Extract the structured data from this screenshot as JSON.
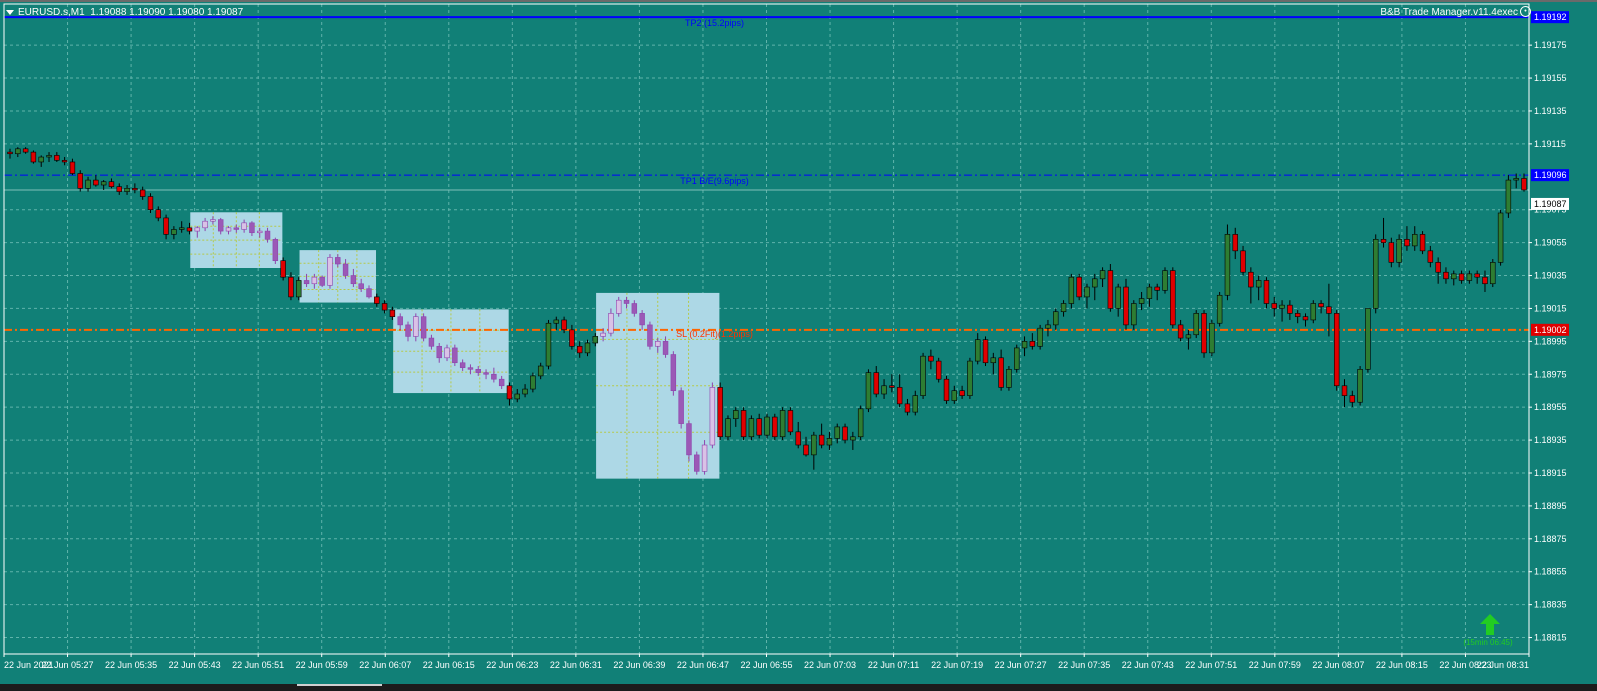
{
  "header": {
    "symbol": "EURUSD.s,M1",
    "ohlc": "1.19088 1.19090 1.19080 1.19087",
    "ea_name": "B&B Trade Manager.v11.4exec"
  },
  "colors": {
    "background": "#118077",
    "bull": "#2e7d32",
    "bear": "#e00000",
    "highlight_candle": "#9b59b6",
    "zone": "#add8e6",
    "tp_line": "#0000ff",
    "sl_line": "#ff6600",
    "bid_label": "#ffffff",
    "signal_arrow": "#22cc22"
  },
  "price_axis": {
    "labels": [
      "1.19192",
      "1.19175",
      "1.19155",
      "1.19135",
      "1.19115",
      "1.19096",
      "1.19087",
      "1.19075",
      "1.19055",
      "1.19035",
      "1.19015",
      "1.19002",
      "1.18995",
      "1.18975",
      "1.18955",
      "1.18935",
      "1.18915",
      "1.18895",
      "1.18875",
      "1.18855",
      "1.18835",
      "1.18815"
    ],
    "ticks": [
      "1.19175",
      "1.19155",
      "1.19135",
      "1.19115",
      "1.19075",
      "1.19055",
      "1.19035",
      "1.19015",
      "1.18995",
      "1.18975",
      "1.18955",
      "1.18935",
      "1.18915",
      "1.18895",
      "1.18875",
      "1.18855",
      "1.18835",
      "1.18815"
    ],
    "tp2_price": "1.19192",
    "tp1_price": "1.19096",
    "current_price": "1.19087",
    "sl_price": "1.19002"
  },
  "time_axis": {
    "labels": [
      "22 Jun 2021",
      "22 Jun 05:27",
      "22 Jun 05:35",
      "22 Jun 05:43",
      "22 Jun 05:51",
      "22 Jun 05:59",
      "22 Jun 06:07",
      "22 Jun 06:15",
      "22 Jun 06:23",
      "22 Jun 06:31",
      "22 Jun 06:39",
      "22 Jun 06:47",
      "22 Jun 06:55",
      "22 Jun 07:03",
      "22 Jun 07:11",
      "22 Jun 07:19",
      "22 Jun 07:27",
      "22 Jun 07:35",
      "22 Jun 07:43",
      "22 Jun 07:51",
      "22 Jun 07:59",
      "22 Jun 08:07",
      "22 Jun 08:15",
      "22 Jun 08:23",
      "22 Jun 08:31"
    ]
  },
  "lines": {
    "tp2_label": "TP2 (15.2pips)",
    "tp1_label": "TP1 B/E(9.6pips)",
    "sl_label": "SL (0.2Fit)(1.2pips)"
  },
  "signal": {
    "icon": "up-arrow-icon",
    "label": "(15min 06:45)"
  },
  "chart_data": {
    "type": "candlestick",
    "symbol": "EURUSD.s",
    "timeframe": "M1",
    "ylim": [
      1.18805,
      1.192
    ],
    "grid": true,
    "candles": [
      [
        1.1911,
        1.19112,
        1.19106,
        1.19109
      ],
      [
        1.19109,
        1.19113,
        1.19107,
        1.19112
      ],
      [
        1.19112,
        1.19113,
        1.19109,
        1.1911
      ],
      [
        1.1911,
        1.19111,
        1.19103,
        1.19104
      ],
      [
        1.19104,
        1.19108,
        1.19101,
        1.19107
      ],
      [
        1.19107,
        1.1911,
        1.19104,
        1.19108
      ],
      [
        1.19108,
        1.1911,
        1.19104,
        1.19105
      ],
      [
        1.19105,
        1.19107,
        1.19102,
        1.19104
      ],
      [
        1.19104,
        1.19106,
        1.19096,
        1.19097
      ],
      [
        1.19097,
        1.19099,
        1.19086,
        1.19088
      ],
      [
        1.19088,
        1.19095,
        1.19086,
        1.19093
      ],
      [
        1.19093,
        1.19096,
        1.19089,
        1.1909
      ],
      [
        1.1909,
        1.19093,
        1.19087,
        1.19092
      ],
      [
        1.19092,
        1.19094,
        1.19088,
        1.19089
      ],
      [
        1.19089,
        1.19091,
        1.19084,
        1.19086
      ],
      [
        1.19086,
        1.1909,
        1.19084,
        1.19088
      ],
      [
        1.19088,
        1.19091,
        1.19085,
        1.19087
      ],
      [
        1.19087,
        1.19089,
        1.19081,
        1.19083
      ],
      [
        1.19083,
        1.19085,
        1.19073,
        1.19075
      ],
      [
        1.19075,
        1.19077,
        1.19068,
        1.1907
      ],
      [
        1.1907,
        1.19072,
        1.19057,
        1.1906
      ],
      [
        1.1906,
        1.19065,
        1.19057,
        1.19063
      ],
      [
        1.19063,
        1.19068,
        1.19061,
        1.19064
      ],
      [
        1.19064,
        1.19067,
        1.1906,
        1.19062
      ],
      [
        1.19062,
        1.19065,
        1.19058,
        1.19064
      ],
      [
        1.19064,
        1.1907,
        1.19062,
        1.19068
      ],
      [
        1.19068,
        1.19071,
        1.19066,
        1.19069
      ],
      [
        1.19069,
        1.1907,
        1.1906,
        1.19062
      ],
      [
        1.19062,
        1.19065,
        1.1906,
        1.19064
      ],
      [
        1.19064,
        1.19066,
        1.19061,
        1.19063
      ],
      [
        1.19063,
        1.19069,
        1.19061,
        1.19067
      ],
      [
        1.19067,
        1.19068,
        1.19059,
        1.19061
      ],
      [
        1.19061,
        1.19064,
        1.19058,
        1.19062
      ],
      [
        1.19062,
        1.19064,
        1.19055,
        1.19057
      ],
      [
        1.19057,
        1.19058,
        1.19042,
        1.19044
      ],
      [
        1.19044,
        1.19046,
        1.19032,
        1.19034
      ],
      [
        1.19034,
        1.19037,
        1.1902,
        1.19022
      ],
      [
        1.19022,
        1.19034,
        1.1902,
        1.19032
      ],
      [
        1.19032,
        1.19036,
        1.19028,
        1.1903
      ],
      [
        1.1903,
        1.19036,
        1.19027,
        1.19034
      ],
      [
        1.19034,
        1.19035,
        1.19028,
        1.19029
      ],
      [
        1.19029,
        1.19048,
        1.19027,
        1.19046
      ],
      [
        1.19046,
        1.19048,
        1.1904,
        1.19042
      ],
      [
        1.19042,
        1.19045,
        1.19033,
        1.19035
      ],
      [
        1.19035,
        1.19039,
        1.19028,
        1.1903
      ],
      [
        1.1903,
        1.19033,
        1.19025,
        1.19027
      ],
      [
        1.19027,
        1.19029,
        1.19021,
        1.19022
      ],
      [
        1.19022,
        1.19024,
        1.19016,
        1.19018
      ],
      [
        1.19018,
        1.1902,
        1.19012,
        1.19014
      ],
      [
        1.19014,
        1.19016,
        1.19008,
        1.1901
      ],
      [
        1.1901,
        1.19012,
        1.19002,
        1.19005
      ],
      [
        1.19005,
        1.19007,
        1.18995,
        1.18998
      ],
      [
        1.18998,
        1.19012,
        1.18995,
        1.1901
      ],
      [
        1.1901,
        1.19012,
        1.18995,
        1.18997
      ],
      [
        1.18997,
        1.18999,
        1.1899,
        1.18992
      ],
      [
        1.18992,
        1.18994,
        1.18982,
        1.18985
      ],
      [
        1.18985,
        1.18993,
        1.18983,
        1.18991
      ],
      [
        1.18991,
        1.18993,
        1.1898,
        1.18982
      ],
      [
        1.18982,
        1.18984,
        1.18977,
        1.18979
      ],
      [
        1.18979,
        1.18981,
        1.18975,
        1.18978
      ],
      [
        1.18978,
        1.1898,
        1.18974,
        1.18976
      ],
      [
        1.18976,
        1.18978,
        1.18972,
        1.18975
      ],
      [
        1.18975,
        1.18979,
        1.1897,
        1.18972
      ],
      [
        1.18972,
        1.18974,
        1.18966,
        1.18968
      ],
      [
        1.18968,
        1.1897,
        1.18956,
        1.1896
      ],
      [
        1.1896,
        1.18966,
        1.18958,
        1.18963
      ],
      [
        1.18963,
        1.18969,
        1.18961,
        1.18966
      ],
      [
        1.18966,
        1.18976,
        1.18964,
        1.18974
      ],
      [
        1.18974,
        1.18982,
        1.18972,
        1.1898
      ],
      [
        1.1898,
        1.19008,
        1.18978,
        1.19006
      ],
      [
        1.19006,
        1.1901,
        1.19002,
        1.19008
      ],
      [
        1.19008,
        1.1901,
        1.19,
        1.19002
      ],
      [
        1.19002,
        1.19005,
        1.1899,
        1.18992
      ],
      [
        1.18992,
        1.18995,
        1.18985,
        1.18988
      ],
      [
        1.18988,
        1.18996,
        1.18986,
        1.18994
      ],
      [
        1.18994,
        1.19,
        1.18992,
        1.18998
      ],
      [
        1.18998,
        1.19003,
        1.18995,
        1.19
      ],
      [
        1.19,
        1.19015,
        1.18998,
        1.19012
      ],
      [
        1.19012,
        1.19022,
        1.1901,
        1.1902
      ],
      [
        1.1902,
        1.19022,
        1.19015,
        1.19018
      ],
      [
        1.19018,
        1.1902,
        1.1901,
        1.19012
      ],
      [
        1.19012,
        1.19014,
        1.19002,
        1.19005
      ],
      [
        1.19005,
        1.19007,
        1.1899,
        1.18992
      ],
      [
        1.18992,
        1.18997,
        1.18988,
        1.18995
      ],
      [
        1.18995,
        1.18998,
        1.18985,
        1.18987
      ],
      [
        1.18987,
        1.18989,
        1.18962,
        1.18965
      ],
      [
        1.18965,
        1.18967,
        1.18942,
        1.18945
      ],
      [
        1.18945,
        1.18947,
        1.18922,
        1.18926
      ],
      [
        1.18926,
        1.18928,
        1.18914,
        1.18916
      ],
      [
        1.18916,
        1.18935,
        1.18914,
        1.18932
      ],
      [
        1.18932,
        1.1897,
        1.1893,
        1.18967
      ],
      [
        1.18967,
        1.1897,
        1.18935,
        1.18937
      ],
      [
        1.18937,
        1.1895,
        1.18935,
        1.18948
      ],
      [
        1.18948,
        1.18955,
        1.18943,
        1.18953
      ],
      [
        1.18953,
        1.18955,
        1.18935,
        1.18937
      ],
      [
        1.18937,
        1.1895,
        1.18935,
        1.18948
      ],
      [
        1.18948,
        1.18951,
        1.18936,
        1.18938
      ],
      [
        1.18938,
        1.18951,
        1.18936,
        1.18949
      ],
      [
        1.18949,
        1.18951,
        1.18935,
        1.18937
      ],
      [
        1.18937,
        1.18955,
        1.18935,
        1.18953
      ],
      [
        1.18953,
        1.18955,
        1.18938,
        1.1894
      ],
      [
        1.1894,
        1.18946,
        1.1893,
        1.18932
      ],
      [
        1.18932,
        1.18937,
        1.18925,
        1.18926
      ],
      [
        1.18926,
        1.1894,
        1.18917,
        1.18938
      ],
      [
        1.18938,
        1.18945,
        1.1893,
        1.18932
      ],
      [
        1.18932,
        1.1894,
        1.18929,
        1.18936
      ],
      [
        1.18936,
        1.18945,
        1.18933,
        1.18943
      ],
      [
        1.18943,
        1.18945,
        1.18933,
        1.18935
      ],
      [
        1.18935,
        1.1894,
        1.18929,
        1.18937
      ],
      [
        1.18937,
        1.18956,
        1.18935,
        1.18954
      ],
      [
        1.18954,
        1.18978,
        1.18952,
        1.18976
      ],
      [
        1.18976,
        1.1898,
        1.18961,
        1.18963
      ],
      [
        1.18963,
        1.18972,
        1.1896,
        1.18968
      ],
      [
        1.18968,
        1.18975,
        1.18964,
        1.18967
      ],
      [
        1.18967,
        1.18975,
        1.18955,
        1.18957
      ],
      [
        1.18957,
        1.1896,
        1.1895,
        1.18952
      ],
      [
        1.18952,
        1.18965,
        1.1895,
        1.18962
      ],
      [
        1.18962,
        1.18988,
        1.1896,
        1.18986
      ],
      [
        1.18986,
        1.1899,
        1.18978,
        1.18983
      ],
      [
        1.18983,
        1.18985,
        1.1897,
        1.18972
      ],
      [
        1.18972,
        1.18974,
        1.18957,
        1.18959
      ],
      [
        1.18959,
        1.18968,
        1.18957,
        1.18965
      ],
      [
        1.18965,
        1.18968,
        1.1896,
        1.18962
      ],
      [
        1.18962,
        1.18985,
        1.1896,
        1.18983
      ],
      [
        1.18983,
        1.19,
        1.18981,
        1.18996
      ],
      [
        1.18996,
        1.18998,
        1.1898,
        1.18982
      ],
      [
        1.18982,
        1.18988,
        1.18975,
        1.18985
      ],
      [
        1.18985,
        1.1899,
        1.18965,
        1.18967
      ],
      [
        1.18967,
        1.1898,
        1.18965,
        1.18978
      ],
      [
        1.18978,
        1.18993,
        1.18976,
        1.18991
      ],
      [
        1.18991,
        1.18998,
        1.18986,
        1.18995
      ],
      [
        1.18995,
        1.19,
        1.1899,
        1.18992
      ],
      [
        1.18992,
        1.19005,
        1.1899,
        1.19003
      ],
      [
        1.19003,
        1.19008,
        1.18998,
        1.19005
      ],
      [
        1.19005,
        1.19015,
        1.19002,
        1.19013
      ],
      [
        1.19013,
        1.1902,
        1.1901,
        1.19018
      ],
      [
        1.19018,
        1.19036,
        1.19015,
        1.19034
      ],
      [
        1.19034,
        1.19036,
        1.1902,
        1.19022
      ],
      [
        1.19022,
        1.1903,
        1.19015,
        1.19028
      ],
      [
        1.19028,
        1.19036,
        1.1902,
        1.19033
      ],
      [
        1.19033,
        1.1904,
        1.19028,
        1.19038
      ],
      [
        1.19038,
        1.19042,
        1.19013,
        1.19015
      ],
      [
        1.19015,
        1.1903,
        1.1901,
        1.19028
      ],
      [
        1.19028,
        1.19033,
        1.19002,
        1.19005
      ],
      [
        1.19005,
        1.1902,
        1.19002,
        1.19018
      ],
      [
        1.19018,
        1.19025,
        1.19014,
        1.19021
      ],
      [
        1.19021,
        1.1903,
        1.19016,
        1.19028
      ],
      [
        1.19028,
        1.1903,
        1.1902,
        1.19026
      ],
      [
        1.19026,
        1.1904,
        1.19024,
        1.19038
      ],
      [
        1.19038,
        1.1904,
        1.19003,
        1.19005
      ],
      [
        1.19005,
        1.19008,
        1.18995,
        1.18997
      ],
      [
        1.18997,
        1.19002,
        1.1899,
        1.18999
      ],
      [
        1.18999,
        1.19014,
        1.18997,
        1.19012
      ],
      [
        1.19012,
        1.19014,
        1.18985,
        1.18988
      ],
      [
        1.18988,
        1.19008,
        1.18986,
        1.19006
      ],
      [
        1.19006,
        1.19025,
        1.19004,
        1.19023
      ],
      [
        1.19023,
        1.19066,
        1.1902,
        1.1906
      ],
      [
        1.1906,
        1.19064,
        1.19045,
        1.1905
      ],
      [
        1.1905,
        1.19053,
        1.19035,
        1.19037
      ],
      [
        1.19037,
        1.1904,
        1.19018,
        1.19028
      ],
      [
        1.19028,
        1.19035,
        1.1902,
        1.19032
      ],
      [
        1.19032,
        1.19034,
        1.19015,
        1.19018
      ],
      [
        1.19018,
        1.19022,
        1.1901,
        1.19015
      ],
      [
        1.19015,
        1.1902,
        1.19007,
        1.19017
      ],
      [
        1.19017,
        1.1902,
        1.19008,
        1.19012
      ],
      [
        1.19012,
        1.19014,
        1.19006,
        1.1901
      ],
      [
        1.1901,
        1.19012,
        1.19004,
        1.19008
      ],
      [
        1.19008,
        1.1902,
        1.19006,
        1.19018
      ],
      [
        1.19018,
        1.1902,
        1.19012,
        1.19016
      ],
      [
        1.19016,
        1.1903,
        1.18998,
        1.19012
      ],
      [
        1.19012,
        1.19014,
        1.18965,
        1.18968
      ],
      [
        1.18968,
        1.18972,
        1.18955,
        1.18962
      ],
      [
        1.18962,
        1.18965,
        1.18955,
        1.18958
      ],
      [
        1.18958,
        1.1898,
        1.18956,
        1.18978
      ],
      [
        1.18978,
        1.1901,
        1.18976,
        1.19015
      ],
      [
        1.19015,
        1.1906,
        1.19012,
        1.19057
      ],
      [
        1.19057,
        1.1907,
        1.19052,
        1.19055
      ],
      [
        1.19055,
        1.19058,
        1.1904,
        1.19043
      ],
      [
        1.19043,
        1.1906,
        1.1904,
        1.19057
      ],
      [
        1.19057,
        1.19065,
        1.1905,
        1.19053
      ],
      [
        1.19053,
        1.19065,
        1.1905,
        1.1906
      ],
      [
        1.1906,
        1.19062,
        1.19048,
        1.1905
      ],
      [
        1.1905,
        1.19053,
        1.1904,
        1.19043
      ],
      [
        1.19043,
        1.19046,
        1.1903,
        1.19037
      ],
      [
        1.19037,
        1.1904,
        1.1903,
        1.19033
      ],
      [
        1.19033,
        1.19038,
        1.19029,
        1.19036
      ],
      [
        1.19036,
        1.19038,
        1.1903,
        1.19032
      ],
      [
        1.19032,
        1.19038,
        1.1903,
        1.19036
      ],
      [
        1.19036,
        1.19038,
        1.1903,
        1.19034
      ],
      [
        1.19034,
        1.19038,
        1.19025,
        1.1903
      ],
      [
        1.1903,
        1.19045,
        1.19028,
        1.19043
      ],
      [
        1.19043,
        1.19075,
        1.19041,
        1.19073
      ],
      [
        1.19073,
        1.19096,
        1.1907,
        1.19093
      ],
      [
        1.19093,
        1.19097,
        1.19088,
        1.19094
      ],
      [
        1.19094,
        1.19097,
        1.19086,
        1.19087
      ]
    ],
    "highlighted_ranges": [
      [
        24,
        34
      ],
      [
        38,
        46
      ],
      [
        50,
        63
      ],
      [
        76,
        90
      ]
    ]
  }
}
